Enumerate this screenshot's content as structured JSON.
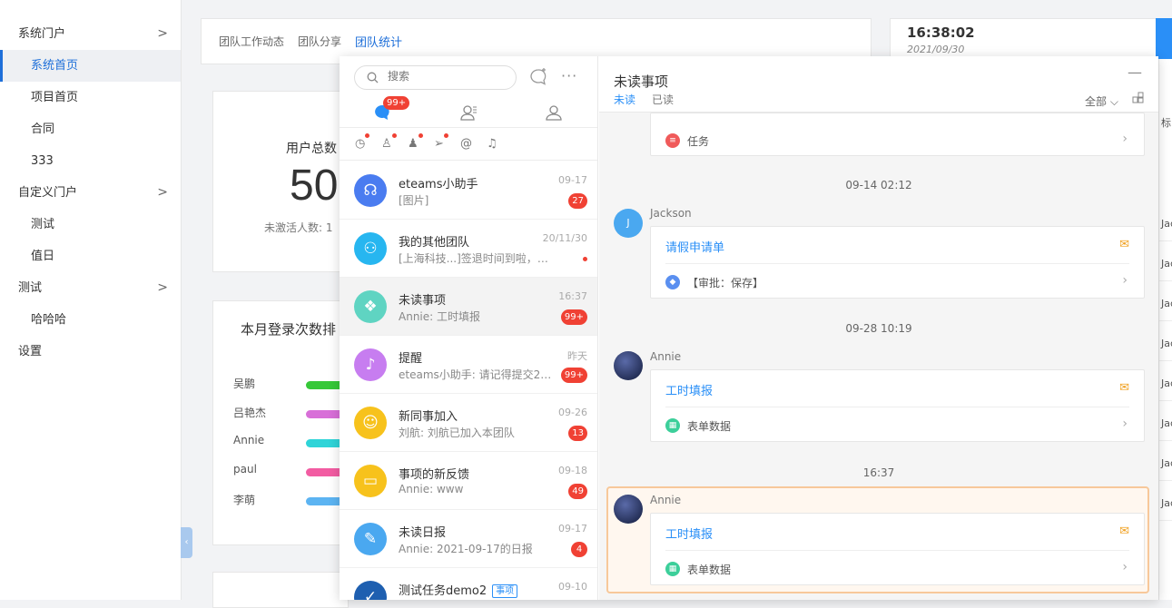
{
  "sidebar": {
    "items": [
      {
        "label": "系统门户",
        "level": "top",
        "chevron": ">"
      },
      {
        "label": "系统首页",
        "level": "sub",
        "active": true
      },
      {
        "label": "项目首页",
        "level": "sub"
      },
      {
        "label": "合同",
        "level": "sub"
      },
      {
        "label": "333",
        "level": "sub"
      },
      {
        "label": "自定义门户",
        "level": "top",
        "chevron": ">"
      },
      {
        "label": "测试",
        "level": "sub"
      },
      {
        "label": "值日",
        "level": "sub"
      },
      {
        "label": "测试",
        "level": "top",
        "chevron": ">"
      },
      {
        "label": "哈哈哈",
        "level": "sub"
      },
      {
        "label": "设置",
        "level": "top"
      }
    ],
    "collapse_glyph": "‹"
  },
  "dashboard": {
    "tabs": [
      "团队工作动态",
      "团队分享",
      "团队统计"
    ],
    "active_tab": 2,
    "stat": {
      "label": "用户总数",
      "value": "50",
      "sub": "未激活人数: 1"
    },
    "rank": {
      "title": "本月登录次数排",
      "rows": [
        {
          "name": "吴鹏",
          "color": "#36c838"
        },
        {
          "name": "吕艳杰",
          "color": "#d86fd8"
        },
        {
          "name": "Annie",
          "color": "#2fd4d8"
        },
        {
          "name": "paul",
          "color": "#f25ca2"
        },
        {
          "name": "李萌",
          "color": "#5cb4f2"
        }
      ]
    },
    "clock": {
      "time": "16:38:02",
      "date": "2021/09/30"
    },
    "right_list": {
      "header": "标",
      "cells": [
        "Jac",
        "Jac",
        "Jac",
        "Jac",
        "Jac",
        "Jac",
        "Jac",
        "Jac"
      ]
    }
  },
  "messenger": {
    "search_placeholder": "搜索",
    "more_glyph": "···",
    "main_tab_badge": "99+",
    "filter_icons": [
      "clock-icon",
      "person-icon",
      "group-icon",
      "send-icon",
      "at-icon",
      "mute-icon"
    ],
    "conversations": [
      {
        "name": "eteams小助手",
        "preview": "[图片]",
        "time": "09-17",
        "count": "27",
        "color": "#4a7cf0",
        "icon": "headset-icon",
        "glyph": "☊"
      },
      {
        "name": "我的其他团队",
        "preview": "[上海科技...]签退时间到啦，别...",
        "time": "20/11/30",
        "dot": true,
        "color": "#27b6f0",
        "icon": "team-icon",
        "glyph": "⚇"
      },
      {
        "name": "未读事项",
        "preview": "Annie: 工时填报",
        "time": "16:37",
        "count": "99+",
        "color": "#5fd4c2",
        "icon": "layers-icon",
        "glyph": "❖",
        "selected": true
      },
      {
        "name": "提醒",
        "preview": "eteams小助手: 请记得提交2021-09...",
        "time": "昨天",
        "count": "99+",
        "color": "#c77df0",
        "icon": "bell-icon",
        "glyph": "♪"
      },
      {
        "name": "新同事加入",
        "preview": "刘航: 刘航已加入本团队",
        "time": "09-26",
        "count": "13",
        "color": "#f7c21c",
        "icon": "people-icon",
        "glyph": "☺"
      },
      {
        "name": "事项的新反馈",
        "preview": "Annie: www",
        "time": "09-18",
        "count": "49",
        "color": "#f7c21c",
        "icon": "feedback-icon",
        "glyph": "▭"
      },
      {
        "name": "未读日报",
        "preview": "Annie: 2021-09-17的日报",
        "time": "09-17",
        "count": "4",
        "color": "#4aa8f0",
        "icon": "edit-icon",
        "glyph": "✎"
      },
      {
        "name": "测试任务demo2",
        "tag": "事项",
        "preview": "",
        "time": "09-10",
        "color": "#1e5fb0",
        "icon": "task-icon",
        "glyph": "✓"
      }
    ],
    "detail": {
      "title": "未读事项",
      "tab_unread": "未读",
      "tab_read": "已读",
      "filter": "全部",
      "minimize": "—",
      "top_card": {
        "label": "任务",
        "icon_color": "#f05a5a"
      },
      "groups": [
        {
          "time": "09-14 02:12",
          "sender": "Jackson",
          "avatar_letter": "J",
          "title": "请假申请单",
          "item": "【审批：保存】",
          "icon_color": "#5a8ff0"
        },
        {
          "time": "09-28 10:19",
          "sender": "Annie",
          "title": "工时填报",
          "item": "表单数据",
          "icon_color": "#3ccf9a"
        },
        {
          "time": "16:37",
          "sender": "Annie",
          "title": "工时填报",
          "item": "表单数据",
          "icon_color": "#3ccf9a",
          "highlighted": true
        }
      ]
    }
  }
}
